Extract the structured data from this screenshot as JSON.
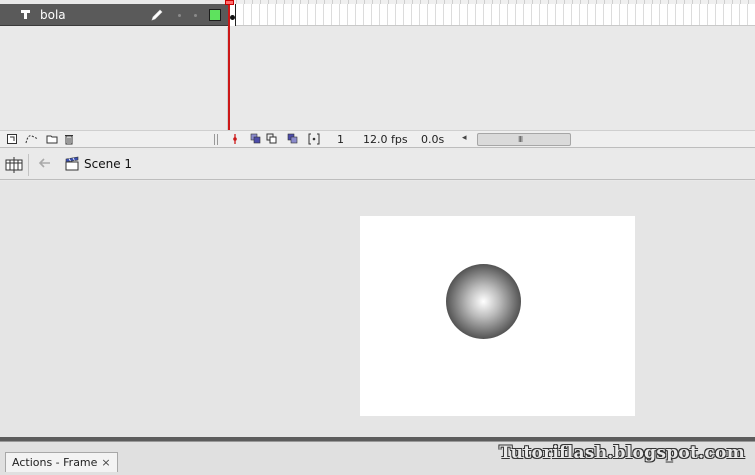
{
  "timeline": {
    "layer": {
      "name": "bola",
      "color": "#5ee25e"
    },
    "controls": {
      "current_frame": "1",
      "frame_rate": "12.0 fps",
      "elapsed_time": "0.0s",
      "scroll_left": "◂",
      "scroll_grip": "III"
    }
  },
  "edit_bar": {
    "scene_label": "Scene 1"
  },
  "stage": {
    "background": "#ffffff"
  },
  "panel": {
    "tab_label": "Actions - Frame",
    "tab_close": "×"
  },
  "watermark": "Tutoriflash.blogspot.com"
}
